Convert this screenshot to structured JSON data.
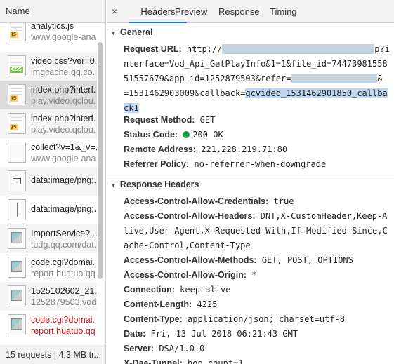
{
  "left": {
    "header": "Name",
    "rows": [
      {
        "name": "analytics.js",
        "host": "www.google-ana",
        "icon": "js-file-icon"
      },
      {
        "name": "video.css?ver=0.",
        "host": "imgcache.qq.co.",
        "icon": "css-file-icon"
      },
      {
        "name": "index.php?interf.",
        "host": "play.video.qclou.",
        "icon": "js-file-icon"
      },
      {
        "name": "index.php?interf.",
        "host": "play.video.qclou.",
        "icon": "js-file-icon"
      },
      {
        "name": "collect?v=1&_v=.",
        "host": "www.google-ana",
        "icon": "blank-file-icon"
      },
      {
        "name": "data:image/png;.",
        "host": "",
        "icon": "image-embed-icon"
      },
      {
        "name": "data:image/png;.",
        "host": "",
        "icon": "image-bar-icon"
      },
      {
        "name": "ImportService?...",
        "host": "tudg.qq.com/dat.",
        "icon": "image-file-icon"
      },
      {
        "name": "code.cgi?domai.",
        "host": "report.huatuo.qq",
        "icon": "image-file-icon"
      },
      {
        "name": "1525102602_21..",
        "host": "1252879503.vod.",
        "icon": "image-file-icon"
      },
      {
        "name": "code.cgi?domai.",
        "host": "report.huatuo.qq",
        "icon": "image-file-icon"
      }
    ],
    "status": "15 requests | 4.3 MB tr..."
  },
  "tabs": {
    "close": "×",
    "items": [
      "Headers",
      "Preview",
      "Response",
      "Timing"
    ]
  },
  "general": {
    "title": "General",
    "url_key": "Request URL:",
    "url_part1": "http://",
    "url_part2": "p?interface=Vod_Api_GetPlayInfo&1=1&file_id=7447398155851557679&app_id=1252879503&refer=",
    "url_part3": "&_=1531462903009&callback=",
    "url_callback": "qcvideo_1531462901850_callback1",
    "method_key": "Request Method:",
    "method_val": "GET",
    "status_key": "Status Code:",
    "status_val": "200 OK",
    "status_color": "#16a34a",
    "remote_key": "Remote Address:",
    "remote_val": "221.228.219.71:80",
    "referrer_key": "Referrer Policy:",
    "referrer_val": "no-referrer-when-downgrade"
  },
  "response": {
    "title": "Response Headers",
    "headers": [
      {
        "k": "Access-Control-Allow-Credentials:",
        "v": "true"
      },
      {
        "k": "Access-Control-Allow-Headers:",
        "v": "DNT,X-CustomHeader,Keep-Alive,User-Agent,X-Requested-With,If-Modified-Since,Cache-Control,Content-Type"
      },
      {
        "k": "Access-Control-Allow-Methods:",
        "v": "GET, POST, OPTIONS"
      },
      {
        "k": "Access-Control-Allow-Origin:",
        "v": "*"
      },
      {
        "k": "Connection:",
        "v": "keep-alive"
      },
      {
        "k": "Content-Length:",
        "v": "4225"
      },
      {
        "k": "Content-Type:",
        "v": "application/json; charset=utf-8"
      },
      {
        "k": "Date:",
        "v": "Fri, 13 Jul 2018 06:21:43 GMT"
      },
      {
        "k": "Server:",
        "v": "DSA/1.0.0"
      },
      {
        "k": "X-Daa-Tunnel:",
        "v": "hop_count=1"
      }
    ]
  }
}
